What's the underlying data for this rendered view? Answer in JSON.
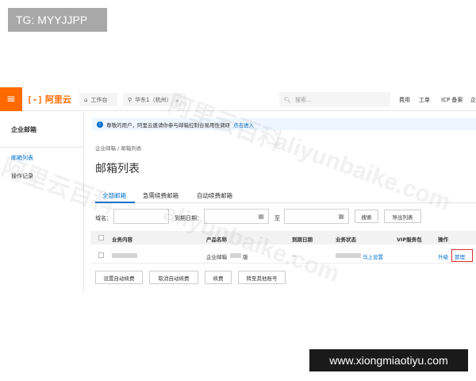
{
  "overlay": {
    "tg_label": "TG: MYYJJPP",
    "site_label": "www.xiongmiaotiyu.com"
  },
  "topbar": {
    "menu_icon": "≡",
    "logo_mark": "[-]",
    "logo_text": "阿里云",
    "workbench": "工作台",
    "region": "华东1（杭州）",
    "search_placeholder": "搜索...",
    "links": [
      "费用",
      "工单",
      "ICP 备案",
      "企"
    ]
  },
  "sidebar": {
    "title": "企业邮箱",
    "items": [
      {
        "label": "邮箱列表",
        "active": true
      },
      {
        "label": "操作记录",
        "active": false
      }
    ]
  },
  "notice": {
    "text": "尊敬的用户，阿里云邀请你参与邮箱控制台易用性调研",
    "link": "点击进入"
  },
  "breadcrumb": "企业邮箱 / 邮箱列表",
  "page_title": "邮箱列表",
  "tabs": [
    {
      "label": "全部邮箱",
      "active": true
    },
    {
      "label": "急需续费邮箱",
      "active": false
    },
    {
      "label": "自动续费邮箱",
      "active": false
    }
  ],
  "filters": {
    "domain_label": "域名：",
    "expiry_label": "到期日期：",
    "to_label": "至",
    "search_button": "搜索",
    "export_button": "导出列表"
  },
  "table": {
    "headers": [
      "业务内容",
      "产品名称",
      "到期日期",
      "业务状态",
      "VIP服务包",
      "操作"
    ],
    "row": {
      "product": "企业邮箱",
      "product_suffix": "版",
      "expiry": "--",
      "status_link": "马上设置",
      "upgrade": "升级",
      "manage": "管理"
    }
  },
  "actions": [
    "设置自动续费",
    "取消自动续费",
    "续费",
    "转至其他账号"
  ],
  "watermark": {
    "texts": [
      "阿里云百科",
      "aliyunbaike.com",
      "阿里云百科",
      "aliyunbaike.com"
    ]
  },
  "colors": {
    "brand": "#ff6a00",
    "link": "#0070cc",
    "highlight_box": "#d9302c"
  }
}
